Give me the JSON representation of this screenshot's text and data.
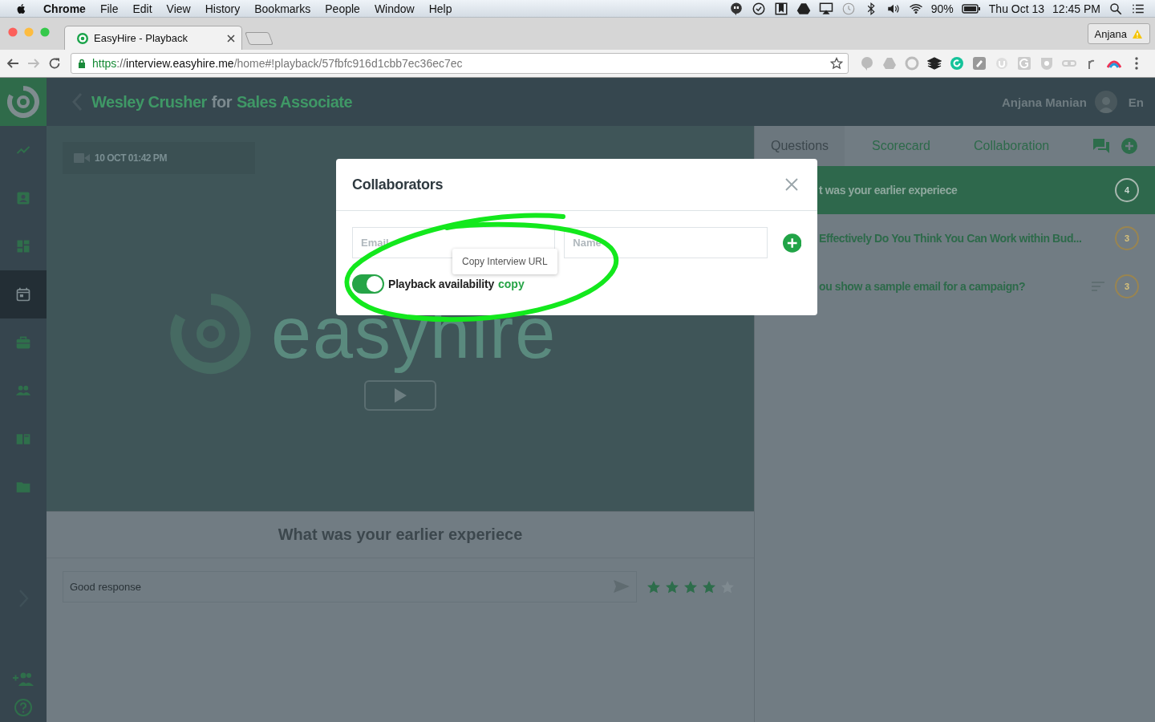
{
  "menubar": {
    "app": "Chrome",
    "menus": [
      "File",
      "Edit",
      "View",
      "History",
      "Bookmarks",
      "People",
      "Window",
      "Help"
    ],
    "battery": "90%",
    "date": "Thu Oct 13",
    "time": "12:45 PM"
  },
  "browser": {
    "tab": {
      "title": "EasyHire - Playback"
    },
    "profile": "Anjana",
    "url": {
      "scheme": "https",
      "separator": "://",
      "host": "interview.easyhire.me",
      "path": "/home#!playback/57fbfc916d1cbb7ec36ec7ec"
    }
  },
  "header": {
    "candidate": "Wesley Crusher",
    "connector": "for",
    "position": "Sales Associate",
    "user": "Anjana Manian",
    "language": "En"
  },
  "sidebar": {
    "items": [
      {
        "kind": "trend",
        "selected": false
      },
      {
        "kind": "contact",
        "selected": false
      },
      {
        "kind": "dashboard",
        "selected": false
      },
      {
        "kind": "calendar",
        "selected": true
      },
      {
        "kind": "briefcase",
        "selected": false
      },
      {
        "kind": "people",
        "selected": false
      },
      {
        "kind": "book",
        "selected": false
      },
      {
        "kind": "folder",
        "selected": false
      }
    ]
  },
  "video": {
    "timestamp": "10 OCT 01:42 PM",
    "logo_text": "easyhire"
  },
  "response": {
    "question": "What was your earlier experiece",
    "comment": "Good response",
    "stars": 4
  },
  "panel": {
    "tabs": [
      {
        "label": "Questions",
        "selected": true
      },
      {
        "label": "Scorecard",
        "selected": false
      },
      {
        "label": "Collaboration",
        "selected": false
      }
    ],
    "questions": [
      {
        "text": "t was your earlier experiece",
        "score": "4",
        "selected": true,
        "notes": false
      },
      {
        "text": "Effectively Do You Think You Can Work within Bud...",
        "score": "3",
        "selected": false,
        "notes": false
      },
      {
        "text": "ou show a sample email for a campaign?",
        "score": "3",
        "selected": false,
        "notes": true
      }
    ]
  },
  "modal": {
    "title": "Collaborators",
    "email_placeholder": "Email",
    "name_placeholder": "Name",
    "tooltip": "Copy Interview URL",
    "playback": {
      "label": "Playback availability",
      "on": true,
      "link": "copy"
    }
  }
}
